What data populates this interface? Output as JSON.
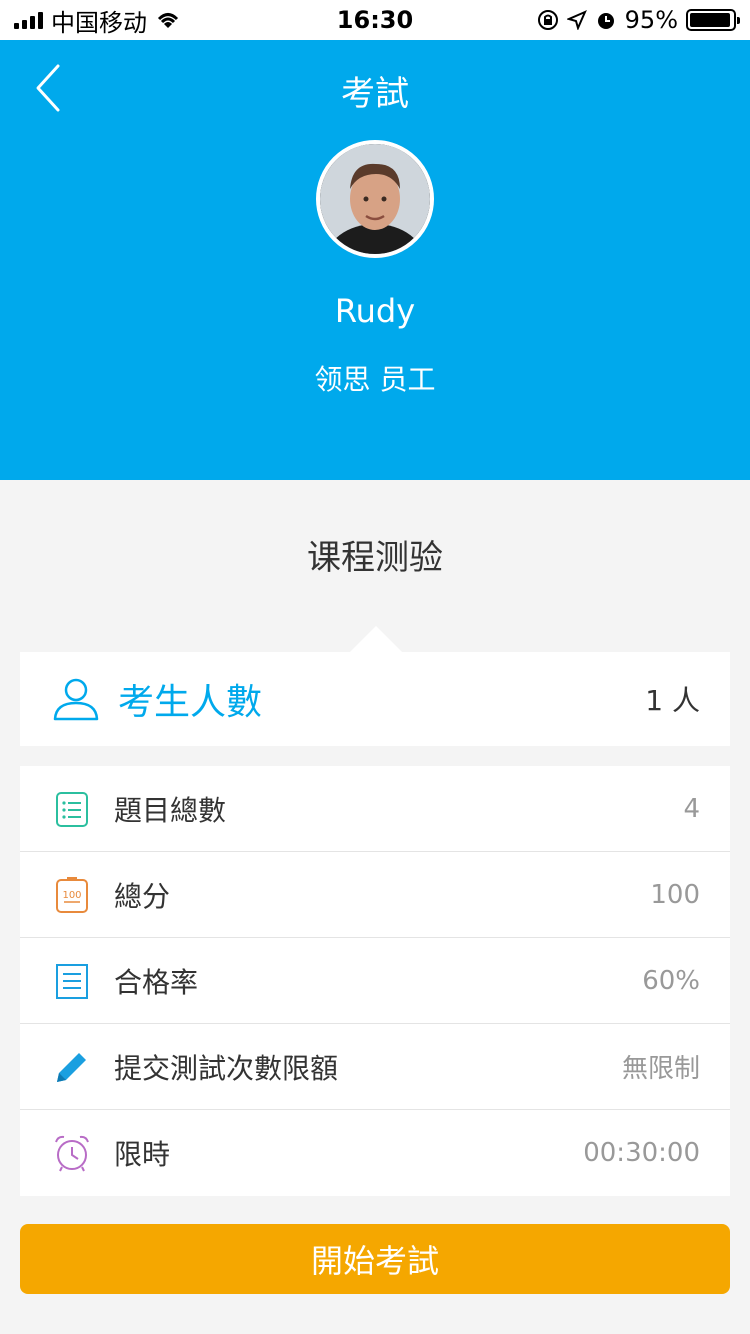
{
  "status_bar": {
    "carrier": "中国移动",
    "time": "16:30",
    "battery": "95%",
    "battery_level": 0.95
  },
  "header": {
    "title": "考試",
    "user_name": "Rudy",
    "user_role": "领思 员工"
  },
  "main": {
    "section_title": "课程测验",
    "examinee": {
      "label": "考生人數",
      "value": "1 人",
      "icon": "user-icon"
    },
    "info_rows": [
      {
        "label": "題目總數",
        "value": "4",
        "icon": "list-icon",
        "color": "#2bbf9f"
      },
      {
        "label": "總分",
        "value": "100",
        "icon": "score-icon",
        "color": "#e88a3c"
      },
      {
        "label": "合格率",
        "value": "60%",
        "icon": "document-icon",
        "color": "#1a9fe0"
      },
      {
        "label": "提交測試次數限額",
        "value": "無限制",
        "icon": "pencil-icon",
        "color": "#1a9fe0"
      },
      {
        "label": "限時",
        "value": "00:30:00",
        "icon": "alarm-clock-icon",
        "color": "#b86cc6"
      }
    ],
    "start_button": "開始考試"
  },
  "colors": {
    "header_bg": "#00a9ec",
    "accent": "#00a9ec",
    "button_bg": "#f5a700"
  }
}
